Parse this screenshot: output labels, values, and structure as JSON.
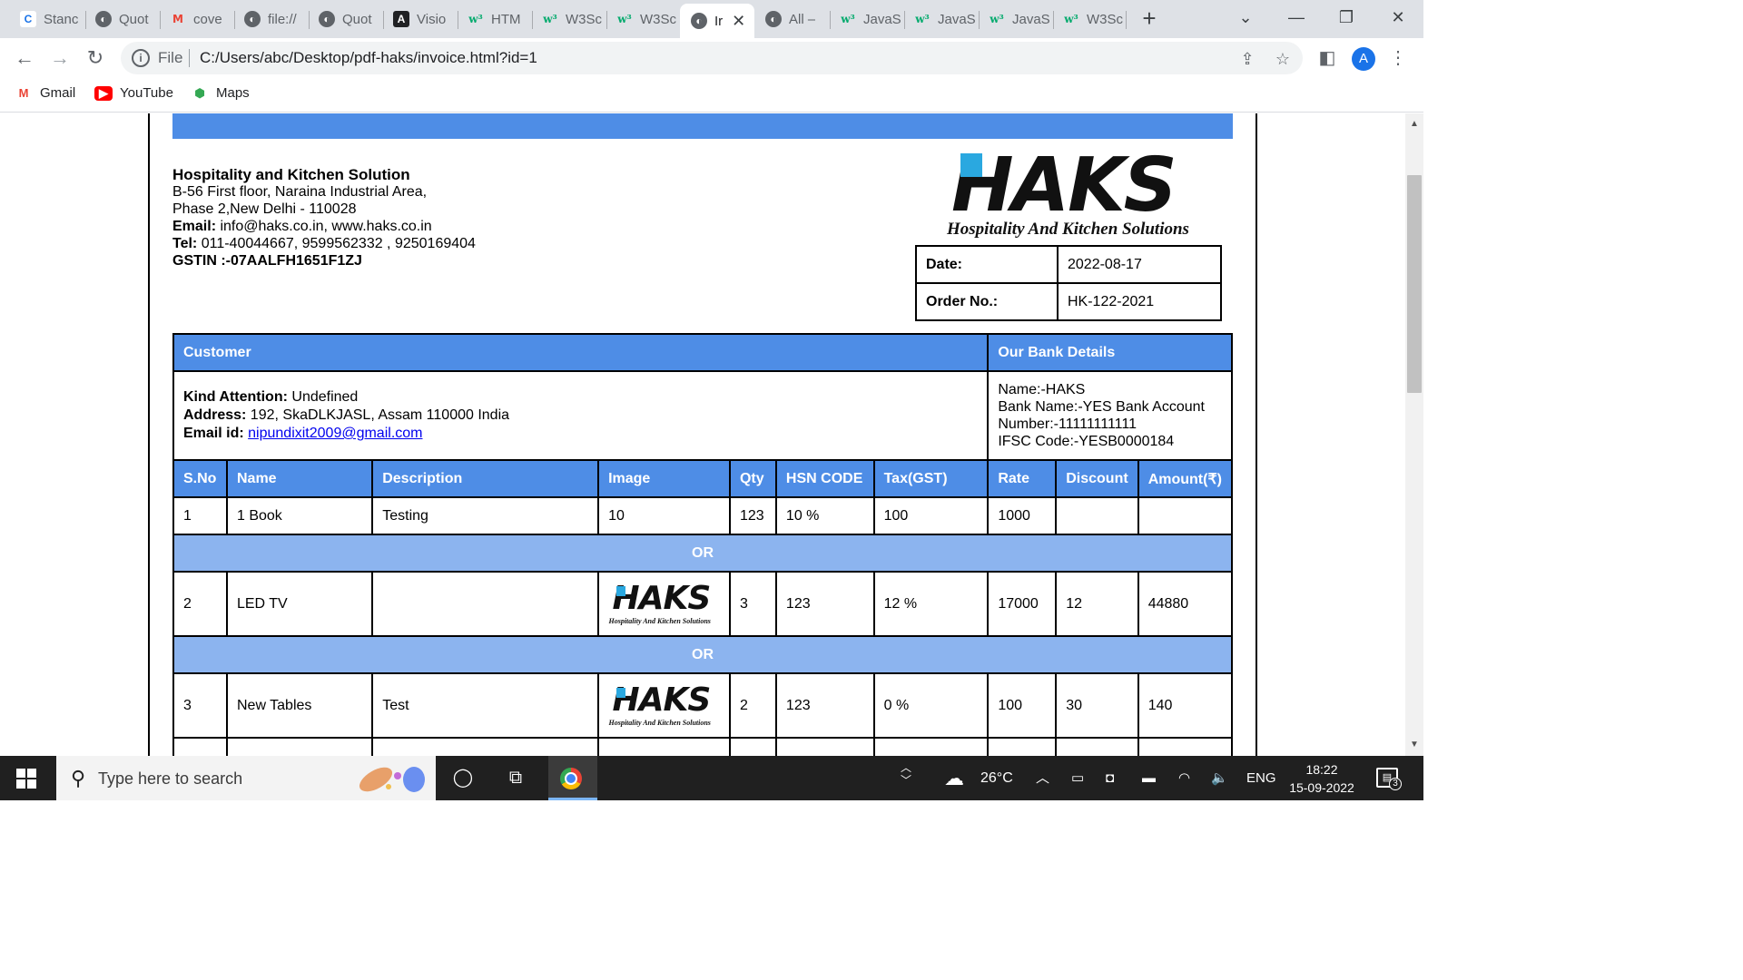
{
  "browser": {
    "tabs": [
      {
        "title": "Stanc",
        "icon": "c-logo-icon"
      },
      {
        "title": "Quot",
        "icon": "globe-icon"
      },
      {
        "title": "cove",
        "icon": "gmail-icon"
      },
      {
        "title": "file://",
        "icon": "globe-icon"
      },
      {
        "title": "Quot",
        "icon": "globe-icon"
      },
      {
        "title": "Visio",
        "icon": "angular-icon"
      },
      {
        "title": "HTM",
        "icon": "w3schools-icon"
      },
      {
        "title": "W3Sc",
        "icon": "w3schools-icon"
      },
      {
        "title": "W3Sc",
        "icon": "w3schools-icon"
      },
      {
        "title": "Ir",
        "icon": "globe-icon",
        "active": true
      },
      {
        "title": "All –",
        "icon": "globe-icon"
      },
      {
        "title": "JavaS",
        "icon": "w3schools-icon"
      },
      {
        "title": "JavaS",
        "icon": "w3schools-icon"
      },
      {
        "title": "JavaS",
        "icon": "w3schools-icon"
      },
      {
        "title": "W3Sc",
        "icon": "w3schools-icon"
      }
    ],
    "address": {
      "scheme_label": "File",
      "url": "C:/Users/abc/Desktop/pdf-haks/invoice.html?id=1"
    },
    "profile_initial": "A",
    "bookmarks": [
      {
        "label": "Gmail",
        "icon": "gmail-icon"
      },
      {
        "label": "YouTube",
        "icon": "youtube-icon"
      },
      {
        "label": "Maps",
        "icon": "maps-icon"
      }
    ]
  },
  "invoice": {
    "company": {
      "name": "Hospitality and Kitchen Solution",
      "address1": "B-56 First floor, Naraina Industrial Area,",
      "address2": "Phase 2,New Delhi - 110028",
      "email_label": "Email:",
      "email_value": " info@haks.co.in, www.haks.co.in",
      "tel_label": "Tel:",
      "tel_value": " 011-40044667, 9599562332 , 9250169404",
      "gstin": "GSTIN :-07AALFH1651F1ZJ"
    },
    "logo": {
      "word": "HAKS",
      "tagline": "Hospitality And Kitchen Solutions"
    },
    "meta": {
      "date_label": "Date:",
      "date_value": "2022-08-17",
      "order_label": "Order No.:",
      "order_value": "HK-122-2021"
    },
    "customer": {
      "header": "Customer",
      "attention_label": "Kind Attention:",
      "attention_value": " Undefined",
      "address_label": "Address:",
      "address_value": " 192, SkaDLKJASL, Assam 110000 India",
      "email_label": "Email id:",
      "email_value": "nipundixit2009@gmail.com"
    },
    "bank": {
      "header": "Our Bank Details",
      "line1": "Name:-HAKS",
      "line2": "Bank Name:-YES Bank Account",
      "line3": "Number:-11111111111",
      "line4": "IFSC Code:-YESB0000184"
    },
    "columns": [
      "S.No",
      "Name",
      "Description",
      "Image",
      "Qty",
      "HSN CODE",
      "Tax(GST)",
      "Rate",
      "Discount",
      "Amount(₹)"
    ],
    "separator_label": "OR",
    "items": [
      {
        "sno": "1",
        "name": "1 Book",
        "description": "Testing",
        "image": "10",
        "qty": "123",
        "hsn": "10 %",
        "tax": "100",
        "rate": "1000",
        "discount": "",
        "amount": ""
      },
      {
        "sno": "2",
        "name": "LED TV",
        "description": "",
        "image": "logo",
        "qty": "3",
        "hsn": "123",
        "tax": "12 %",
        "rate": "17000",
        "discount": "12",
        "amount": "44880"
      },
      {
        "sno": "3",
        "name": "New Tables",
        "description": "Test",
        "image": "logo",
        "qty": "2",
        "hsn": "123",
        "tax": "0 %",
        "rate": "100",
        "discount": "30",
        "amount": "140"
      }
    ]
  },
  "taskbar": {
    "search_placeholder": "Type here to search",
    "weather": "26°C",
    "language": "ENG",
    "time": "18:22",
    "date": "15-09-2022",
    "notification_count": "3"
  },
  "colors": {
    "header_blue": "#4e8de6",
    "or_row_blue": "#8cb4ef",
    "logo_accent": "#2aa8e0"
  }
}
